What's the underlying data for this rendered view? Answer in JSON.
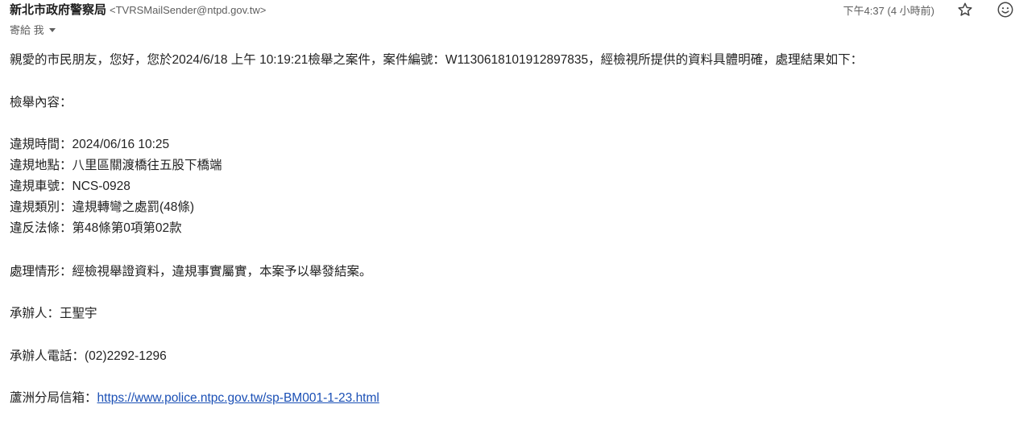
{
  "header": {
    "sender_name": "新北市政府警察局",
    "sender_email": "<TVRSMailSender@ntpd.gov.tw>",
    "timestamp": "下午4:37 (4 小時前)",
    "recipient": "寄給 我",
    "icons": [
      "star-icon",
      "emoji-icon",
      "caret-down-icon"
    ]
  },
  "body": {
    "greeting": "親愛的市民朋友，您好，您於2024/6/18 上午 10:19:21檢舉之案件，案件編號：W1130618101912897835，經檢視所提供的資料具體明確，處理結果如下：",
    "report_heading": "檢舉內容：",
    "violation_time": "違規時間：2024/06/16 10:25",
    "violation_location": "違規地點：八里區關渡橋往五股下橋端",
    "vehicle_plate": "違規車號：NCS-0928",
    "violation_type": "違規類別：違規轉彎之處罰(48條)",
    "law_article": "違反法條：第48條第0項第02款",
    "handling": "處理情形：經檢視舉證資料，違規事實屬實，本案予以舉發結案。",
    "officer": "承辦人：王聖宇",
    "officer_phone": "承辦人電話：(02)2292-1296",
    "mailbox_label": "蘆洲分局信箱：",
    "mailbox_url": "https://www.police.ntpc.gov.tw/sp-BM001-1-23.html"
  },
  "colors": {
    "link": "#1a4fb5",
    "text": "#222222",
    "muted": "#5e5e5e"
  }
}
